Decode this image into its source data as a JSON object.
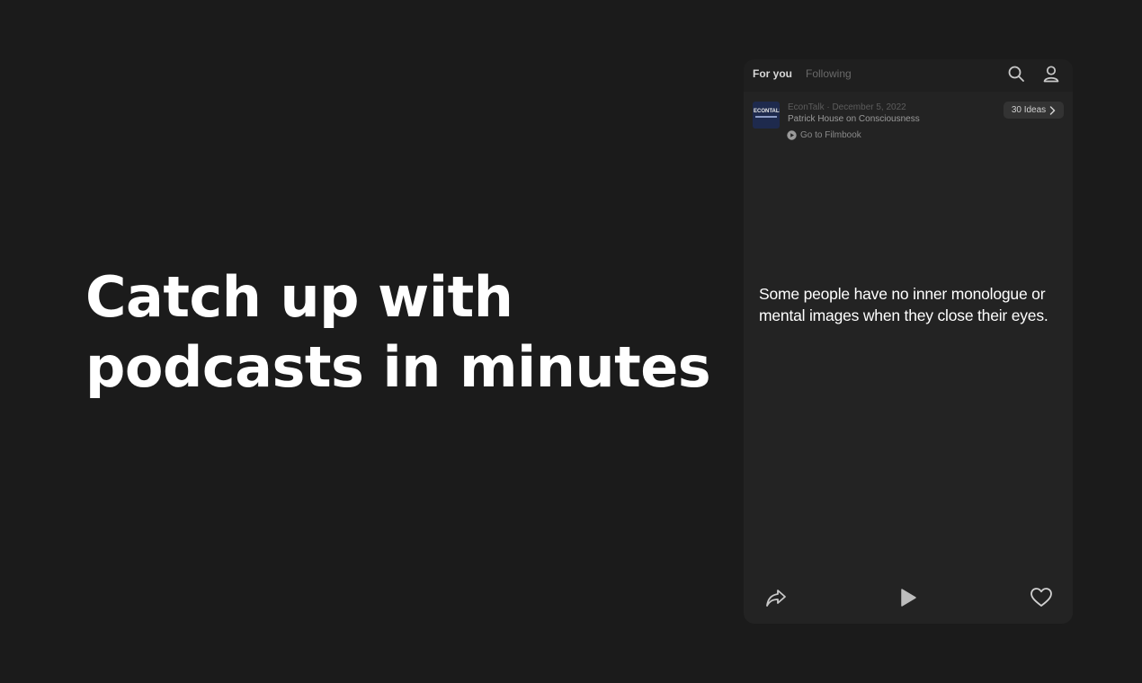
{
  "headline": {
    "line1": "Catch up with",
    "line2": "podcasts in minutes"
  },
  "app": {
    "tabs": [
      {
        "label": "For you",
        "active": true
      },
      {
        "label": "Following",
        "active": false
      }
    ],
    "icons": {
      "search": "search-icon",
      "profile": "user-icon",
      "share": "share-icon",
      "play": "play-icon",
      "like": "heart-icon",
      "chevron": "chevron-right-icon",
      "goto": "play-circle-icon"
    },
    "episode": {
      "art_label": "ECONTALK",
      "meta": "EconTalk · December 5, 2022",
      "title": "Patrick House on Consciousness",
      "goto_label": "Go to Filmbook",
      "ideas_label": "30 Ideas"
    },
    "idea": {
      "text": "Some people have no inner monologue or mental images when they close their eyes."
    }
  },
  "colors": {
    "background": "#1b1b1b",
    "card": "#232323",
    "text_primary": "#ffffff",
    "text_muted": "#6a6a6a"
  }
}
